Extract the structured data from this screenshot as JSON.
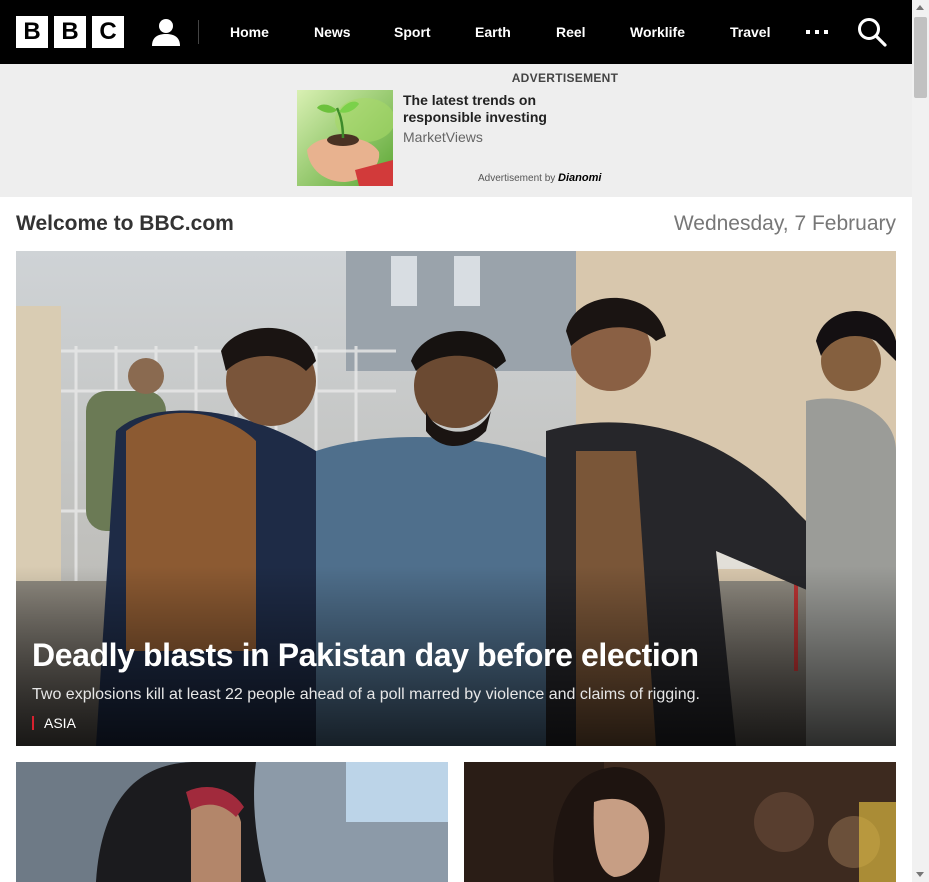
{
  "header": {
    "logo_letters": [
      "B",
      "B",
      "C"
    ],
    "nav": [
      {
        "label": "Home"
      },
      {
        "label": "News"
      },
      {
        "label": "Sport"
      },
      {
        "label": "Earth"
      },
      {
        "label": "Reel"
      },
      {
        "label": "Worklife"
      },
      {
        "label": "Travel"
      }
    ],
    "icons": {
      "account": "user-icon",
      "more": "more-icon",
      "search": "search-icon"
    }
  },
  "ad": {
    "label": "ADVERTISEMENT",
    "headline": "The latest trends on responsible investing",
    "source": "MarketViews",
    "by_text": "Advertisement by",
    "by_brand": "Dianomi"
  },
  "welcome": {
    "title": "Welcome to BBC.com",
    "date": "Wednesday, 7 February"
  },
  "hero": {
    "title": "Deadly blasts in Pakistan day before election",
    "summary": "Two explosions kill at least 22 people ahead of a poll marred by violence and claims of rigging.",
    "tag": "ASIA"
  },
  "colors": {
    "brand_black": "#000000",
    "tag_accent": "#d6212e"
  }
}
